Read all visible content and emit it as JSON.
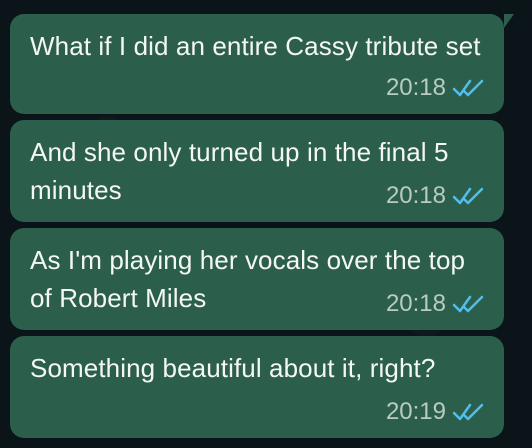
{
  "messages": [
    {
      "text": "What if I did an entire Cassy tribute set",
      "time": "20:18",
      "status": "read"
    },
    {
      "text": "And she only turned up in the final 5 minutes",
      "time": "20:18",
      "status": "read"
    },
    {
      "text": "As I'm playing her vocals over the top of Robert Miles",
      "time": "20:18",
      "status": "read"
    },
    {
      "text": "Something beautiful about it, right?",
      "time": "20:19",
      "status": "read"
    }
  ],
  "colors": {
    "background": "#0b1418",
    "bubble": "#2b5f4b",
    "text": "#f4f7f5",
    "timestamp": "#b9cbc2",
    "read_ticks": "#53bdeb"
  },
  "icons": {
    "read_receipt": "double-check-icon"
  }
}
